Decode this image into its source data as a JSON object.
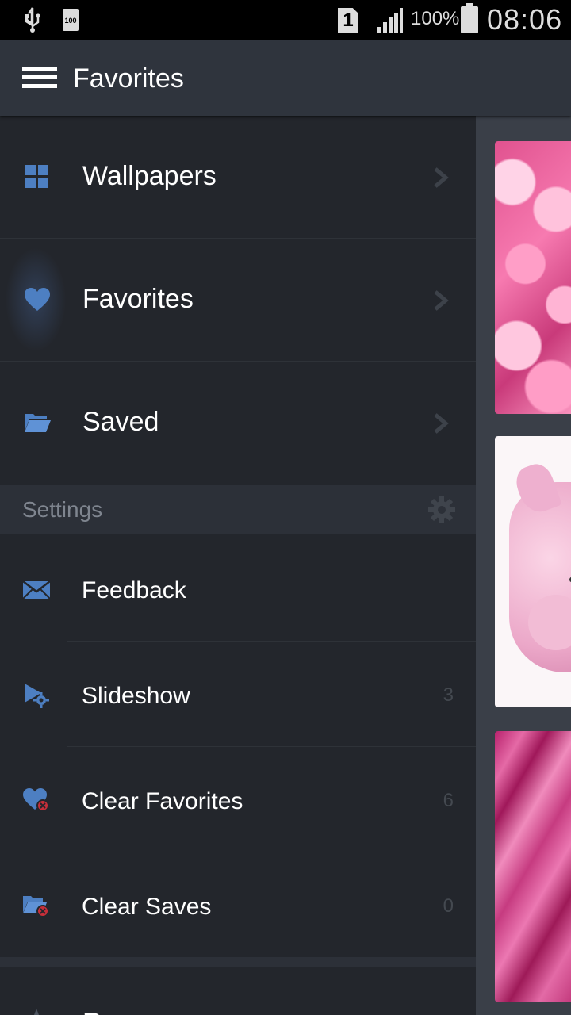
{
  "status_bar": {
    "battery_small_label": "100",
    "sim_slot": "1",
    "battery_percent": "100%",
    "time": "08:06"
  },
  "action_bar": {
    "title": "Favorites",
    "menu_icon": "hamburger-icon"
  },
  "drawer": {
    "nav_items": [
      {
        "label": "Wallpapers",
        "icon": "grid-icon",
        "selected": false
      },
      {
        "label": "Favorites",
        "icon": "heart-icon",
        "selected": true
      },
      {
        "label": "Saved",
        "icon": "folder-open-icon",
        "selected": false
      }
    ],
    "settings_section": {
      "label": "Settings",
      "icon": "gear-icon"
    },
    "settings_items": [
      {
        "label": "Feedback",
        "icon": "envelope-icon",
        "count": ""
      },
      {
        "label": "Slideshow",
        "icon": "play-gear-icon",
        "count": "3"
      },
      {
        "label": "Clear Favorites",
        "icon": "heart-delete-icon",
        "count": "6"
      },
      {
        "label": "Clear Saves",
        "icon": "folder-delete-icon",
        "count": "0"
      }
    ],
    "bottom_item": {
      "label": "R",
      "icon": "star-icon"
    }
  },
  "colors": {
    "accent": "#4d7fc2",
    "drawer_bg": "#23262c",
    "action_bar_bg": "#2f343d",
    "section_bg": "#2c3038"
  }
}
